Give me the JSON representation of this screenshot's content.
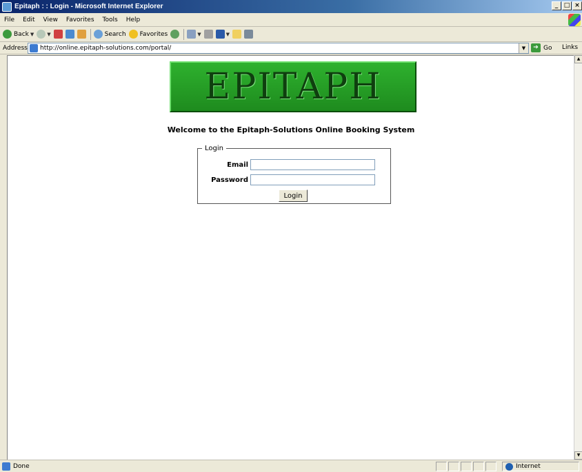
{
  "window": {
    "title": "Epitaph : : Login - Microsoft Internet Explorer"
  },
  "menu": [
    "File",
    "Edit",
    "View",
    "Favorites",
    "Tools",
    "Help"
  ],
  "toolbar": {
    "back": "Back",
    "search": "Search",
    "favorites": "Favorites"
  },
  "address": {
    "label": "Address",
    "url": "http://online.epitaph-solutions.com/portal/",
    "go": "Go",
    "links": "Links"
  },
  "page": {
    "logo_text": "EPITAPH",
    "welcome": "Welcome to the Epitaph-Solutions Online Booking System",
    "login_legend": "Login",
    "email_label": "Email",
    "email_value": "",
    "password_label": "Password",
    "password_value": "",
    "login_button": "Login"
  },
  "status": {
    "text": "Done",
    "zone": "Internet"
  },
  "colors": {
    "titlebar": "#0a246a",
    "logo_green": "#2eb12e",
    "chrome": "#ece9d8"
  }
}
